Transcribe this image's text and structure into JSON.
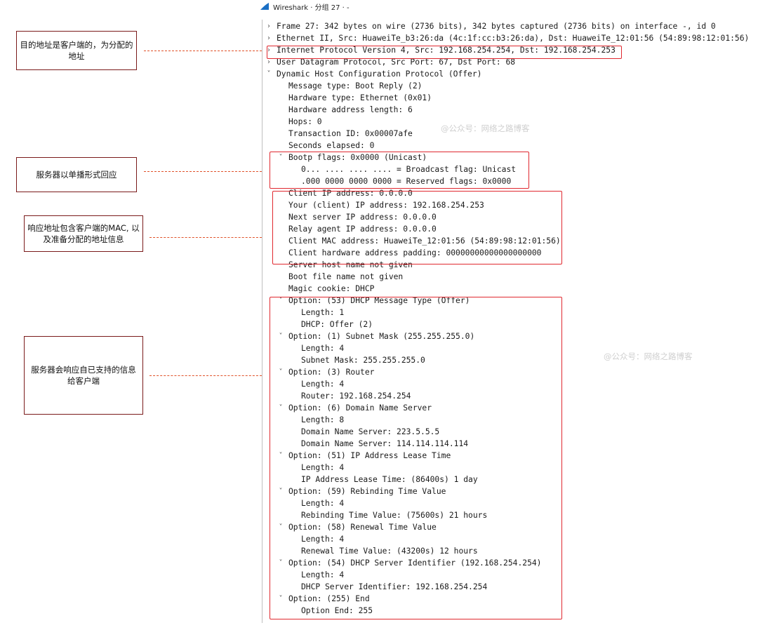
{
  "window": {
    "title": "Wireshark · 分组 27 · -"
  },
  "tree": [
    {
      "indent": 0,
      "toggle": "closed",
      "text": "Frame 27: 342 bytes on wire (2736 bits), 342 bytes captured (2736 bits) on interface -, id 0"
    },
    {
      "indent": 0,
      "toggle": "closed",
      "text": "Ethernet II, Src: HuaweiTe_b3:26:da (4c:1f:cc:b3:26:da), Dst: HuaweiTe_12:01:56 (54:89:98:12:01:56)"
    },
    {
      "indent": 0,
      "toggle": "closed",
      "text": "Internet Protocol Version 4, Src: 192.168.254.254, Dst: 192.168.254.253"
    },
    {
      "indent": 0,
      "toggle": "closed",
      "text": "User Datagram Protocol, Src Port: 67, Dst Port: 68"
    },
    {
      "indent": 0,
      "toggle": "open",
      "text": "Dynamic Host Configuration Protocol (Offer)"
    },
    {
      "indent": 1,
      "toggle": "",
      "text": "Message type: Boot Reply (2)"
    },
    {
      "indent": 1,
      "toggle": "",
      "text": "Hardware type: Ethernet (0x01)"
    },
    {
      "indent": 1,
      "toggle": "",
      "text": "Hardware address length: 6"
    },
    {
      "indent": 1,
      "toggle": "",
      "text": "Hops: 0"
    },
    {
      "indent": 1,
      "toggle": "",
      "text": "Transaction ID: 0x00007afe"
    },
    {
      "indent": 1,
      "toggle": "",
      "text": "Seconds elapsed: 0"
    },
    {
      "indent": 1,
      "toggle": "open",
      "text": "Bootp flags: 0x0000 (Unicast)"
    },
    {
      "indent": 2,
      "toggle": "",
      "text": "0... .... .... .... = Broadcast flag: Unicast"
    },
    {
      "indent": 2,
      "toggle": "",
      "text": ".000 0000 0000 0000 = Reserved flags: 0x0000"
    },
    {
      "indent": 1,
      "toggle": "",
      "text": "Client IP address: 0.0.0.0"
    },
    {
      "indent": 1,
      "toggle": "",
      "text": "Your (client) IP address: 192.168.254.253"
    },
    {
      "indent": 1,
      "toggle": "",
      "text": "Next server IP address: 0.0.0.0"
    },
    {
      "indent": 1,
      "toggle": "",
      "text": "Relay agent IP address: 0.0.0.0"
    },
    {
      "indent": 1,
      "toggle": "",
      "text": "Client MAC address: HuaweiTe_12:01:56 (54:89:98:12:01:56)"
    },
    {
      "indent": 1,
      "toggle": "",
      "text": "Client hardware address padding: 00000000000000000000"
    },
    {
      "indent": 1,
      "toggle": "",
      "text": "Server host name not given"
    },
    {
      "indent": 1,
      "toggle": "",
      "text": "Boot file name not given"
    },
    {
      "indent": 1,
      "toggle": "",
      "text": "Magic cookie: DHCP"
    },
    {
      "indent": 1,
      "toggle": "open",
      "text": "Option: (53) DHCP Message Type (Offer)"
    },
    {
      "indent": 2,
      "toggle": "",
      "text": "Length: 1"
    },
    {
      "indent": 2,
      "toggle": "",
      "text": "DHCP: Offer (2)"
    },
    {
      "indent": 1,
      "toggle": "open",
      "text": "Option: (1) Subnet Mask (255.255.255.0)"
    },
    {
      "indent": 2,
      "toggle": "",
      "text": "Length: 4"
    },
    {
      "indent": 2,
      "toggle": "",
      "text": "Subnet Mask: 255.255.255.0"
    },
    {
      "indent": 1,
      "toggle": "open",
      "text": "Option: (3) Router"
    },
    {
      "indent": 2,
      "toggle": "",
      "text": "Length: 4"
    },
    {
      "indent": 2,
      "toggle": "",
      "text": "Router: 192.168.254.254"
    },
    {
      "indent": 1,
      "toggle": "open",
      "text": "Option: (6) Domain Name Server"
    },
    {
      "indent": 2,
      "toggle": "",
      "text": "Length: 8"
    },
    {
      "indent": 2,
      "toggle": "",
      "text": "Domain Name Server: 223.5.5.5"
    },
    {
      "indent": 2,
      "toggle": "",
      "text": "Domain Name Server: 114.114.114.114"
    },
    {
      "indent": 1,
      "toggle": "open",
      "text": "Option: (51) IP Address Lease Time"
    },
    {
      "indent": 2,
      "toggle": "",
      "text": "Length: 4"
    },
    {
      "indent": 2,
      "toggle": "",
      "text": "IP Address Lease Time: (86400s) 1 day"
    },
    {
      "indent": 1,
      "toggle": "open",
      "text": "Option: (59) Rebinding Time Value"
    },
    {
      "indent": 2,
      "toggle": "",
      "text": "Length: 4"
    },
    {
      "indent": 2,
      "toggle": "",
      "text": "Rebinding Time Value: (75600s) 21 hours"
    },
    {
      "indent": 1,
      "toggle": "open",
      "text": "Option: (58) Renewal Time Value"
    },
    {
      "indent": 2,
      "toggle": "",
      "text": "Length: 4"
    },
    {
      "indent": 2,
      "toggle": "",
      "text": "Renewal Time Value: (43200s) 12 hours"
    },
    {
      "indent": 1,
      "toggle": "open",
      "text": "Option: (54) DHCP Server Identifier (192.168.254.254)"
    },
    {
      "indent": 2,
      "toggle": "",
      "text": "Length: 4"
    },
    {
      "indent": 2,
      "toggle": "",
      "text": "DHCP Server Identifier: 192.168.254.254"
    },
    {
      "indent": 1,
      "toggle": "open",
      "text": "Option: (255) End"
    },
    {
      "indent": 2,
      "toggle": "",
      "text": "Option End: 255"
    }
  ],
  "notes": [
    {
      "name": "note-ip-destination",
      "text": "目的地址是客户端的，为分配的地址"
    },
    {
      "name": "note-unicast-reply",
      "text": "服务器以单播形式回应"
    },
    {
      "name": "note-client-mac",
      "text": "响应地址包含客户端的MAC, 以及准备分配的地址信息"
    },
    {
      "name": "note-server-options",
      "text": "服务器会响应自已支持的信息给客户端"
    }
  ],
  "watermarks": [
    "@公众号：网络之路博客",
    "@公众号：网络之路博客"
  ],
  "colors": {
    "highlight": "#e0282f",
    "dash": "#e0522a",
    "note_border": "#7a1a1a"
  },
  "icons": {
    "toggle_open": "˅",
    "toggle_closed": "›",
    "app_logo": "wireshark-fin-icon"
  }
}
